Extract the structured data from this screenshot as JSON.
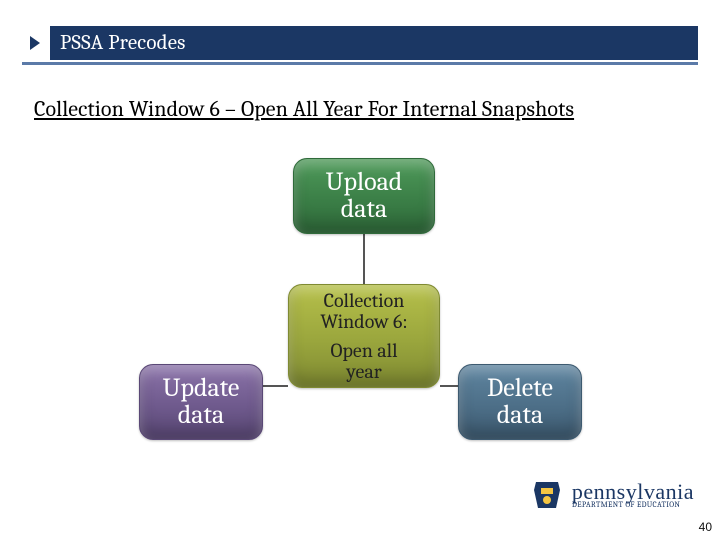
{
  "header": {
    "title": "PSSA Precodes"
  },
  "subtitle": "Collection Window 6 – Open All Year For Internal Snapshots",
  "nodes": {
    "top": {
      "line1": "Upload",
      "line2": "data"
    },
    "middle": {
      "title_l1": "Collection",
      "title_l2": "Window 6:",
      "sub_l1": "Open all",
      "sub_l2": "year"
    },
    "left": {
      "line1": "Update",
      "line2": "data"
    },
    "right": {
      "line1": "Delete",
      "line2": "data"
    }
  },
  "logo": {
    "word": "pennsylvania",
    "sub": "DEPARTMENT OF EDUCATION"
  },
  "page": "40"
}
